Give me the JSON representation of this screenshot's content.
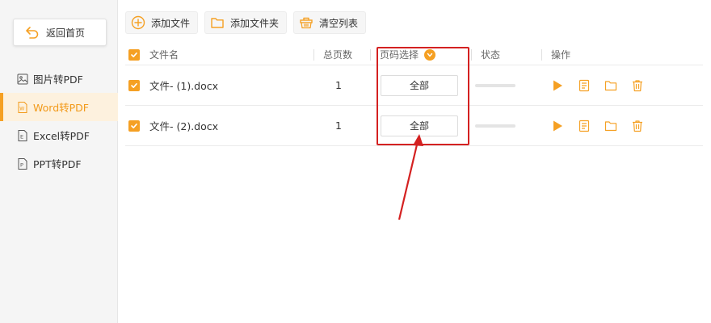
{
  "sidebar": {
    "back_label": "返回首页",
    "items": [
      {
        "label": "图片转PDF",
        "icon": "image-icon"
      },
      {
        "label": "Word转PDF",
        "icon": "word-icon",
        "active": true
      },
      {
        "label": "Excel转PDF",
        "icon": "excel-icon"
      },
      {
        "label": "PPT转PDF",
        "icon": "ppt-icon"
      }
    ]
  },
  "toolbar": {
    "add_file": "添加文件",
    "add_folder": "添加文件夹",
    "clear_list": "清空列表"
  },
  "table": {
    "headers": {
      "filename": "文件名",
      "pages": "总页数",
      "page_select": "页码选择",
      "status": "状态",
      "actions": "操作"
    },
    "rows": [
      {
        "filename": "文件- (1).docx",
        "pages": "1",
        "page_select": "全部",
        "checked": true
      },
      {
        "filename": "文件- (2).docx",
        "pages": "1",
        "page_select": "全部",
        "checked": true
      }
    ]
  },
  "colors": {
    "accent": "#f5a023",
    "annotation": "#d42121"
  }
}
